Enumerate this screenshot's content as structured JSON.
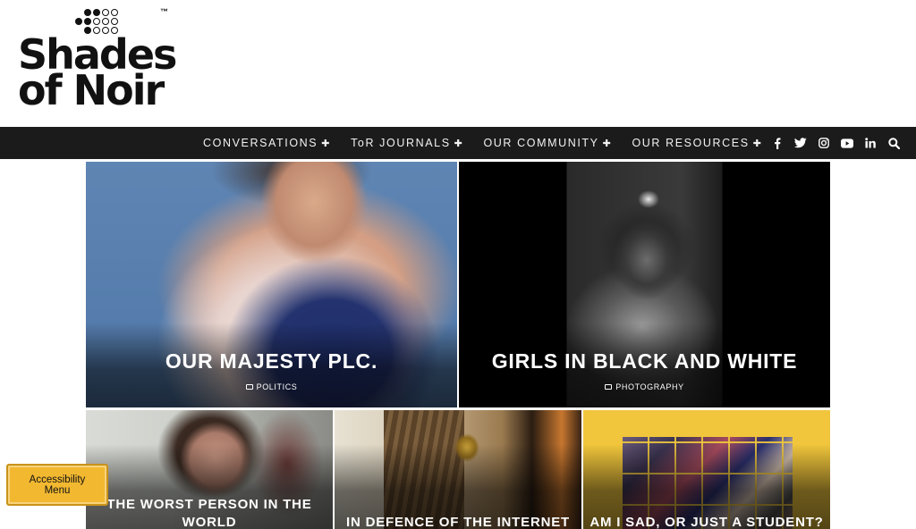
{
  "brand": {
    "line1": "Shades",
    "line2": "of Noir",
    "trademark": "™"
  },
  "nav": {
    "items": [
      {
        "label": "CONVERSATIONS",
        "plus": "✚"
      },
      {
        "label": "ToR JOURNALS",
        "plus": "✚"
      },
      {
        "label": "OUR COMMUNITY",
        "plus": "✚"
      },
      {
        "label": "OUR RESOURCES",
        "plus": "✚"
      }
    ],
    "social_icons": [
      "facebook-icon",
      "twitter-icon",
      "instagram-icon",
      "youtube-icon",
      "linkedin-icon",
      "search-icon"
    ]
  },
  "posts": [
    {
      "title": "OUR MAJESTY PLC.",
      "category": "POLITICS"
    },
    {
      "title": "GIRLS IN BLACK AND WHITE",
      "category": "PHOTOGRAPHY"
    },
    {
      "title": "THE WORST PERSON IN THE WORLD",
      "category": ""
    },
    {
      "title": "IN DEFENCE OF THE INTERNET",
      "category": ""
    },
    {
      "title": "AM I SAD, OR JUST A STUDENT?",
      "category": ""
    }
  ],
  "accessibility": {
    "line1": "Accessibility",
    "line2": "Menu"
  },
  "colors": {
    "navbar": "#1b1b1b",
    "accessibility_button": "#f2b830"
  }
}
